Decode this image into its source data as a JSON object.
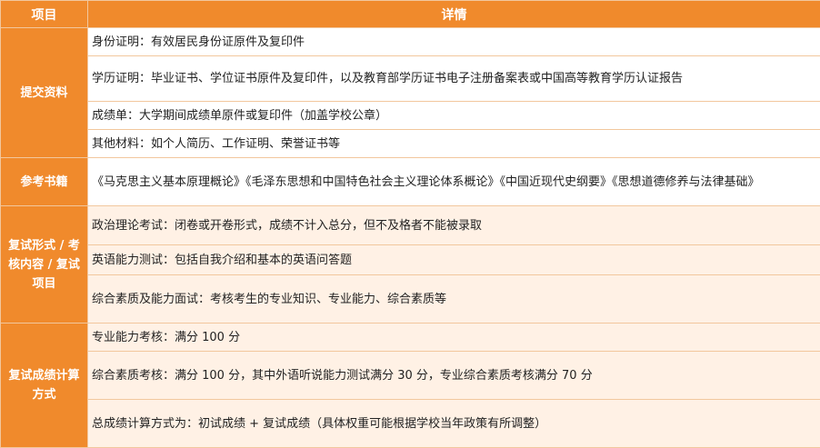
{
  "header": {
    "col1": "项目",
    "col2": "详情"
  },
  "groups": [
    {
      "category": "提交资料",
      "rows": [
        "身份证明：有效居民身份证原件及复印件",
        "学历证明：毕业证书、学位证书原件及复印件，以及教育部学历证书电子注册备案表或中国高等教育学历认证报告",
        "成绩单：大学期间成绩单原件或复印件（加盖学校公章）",
        "其他材料：如个人简历、工作证明、荣誉证书等"
      ]
    },
    {
      "category": "参考书籍",
      "rows": [
        "《马克思主义基本原理概论》《毛泽东思想和中国特色社会主义理论体系概论》《中国近现代史纲要》《思想道德修养与法律基础》"
      ]
    },
    {
      "category": "复试形式 / 考核内容 / 复试项目",
      "rows": [
        "政治理论考试：闭卷或开卷形式，成绩不计入总分，但不及格者不能被录取",
        "英语能力测试：包括自我介绍和基本的英语问答题",
        "综合素质及能力面试：考核考生的专业知识、专业能力、综合素质等"
      ]
    },
    {
      "category": "复试成绩计算方式",
      "rows": [
        "专业能力考核：满分 100 分",
        "综合素质考核：满分 100 分，其中外语听说能力测试满分 30 分，专业综合素质考核满分 70 分",
        "总成绩计算方式为：初试成绩 + 复试成绩（具体权重可能根据学校当年政策有所调整）"
      ]
    }
  ]
}
